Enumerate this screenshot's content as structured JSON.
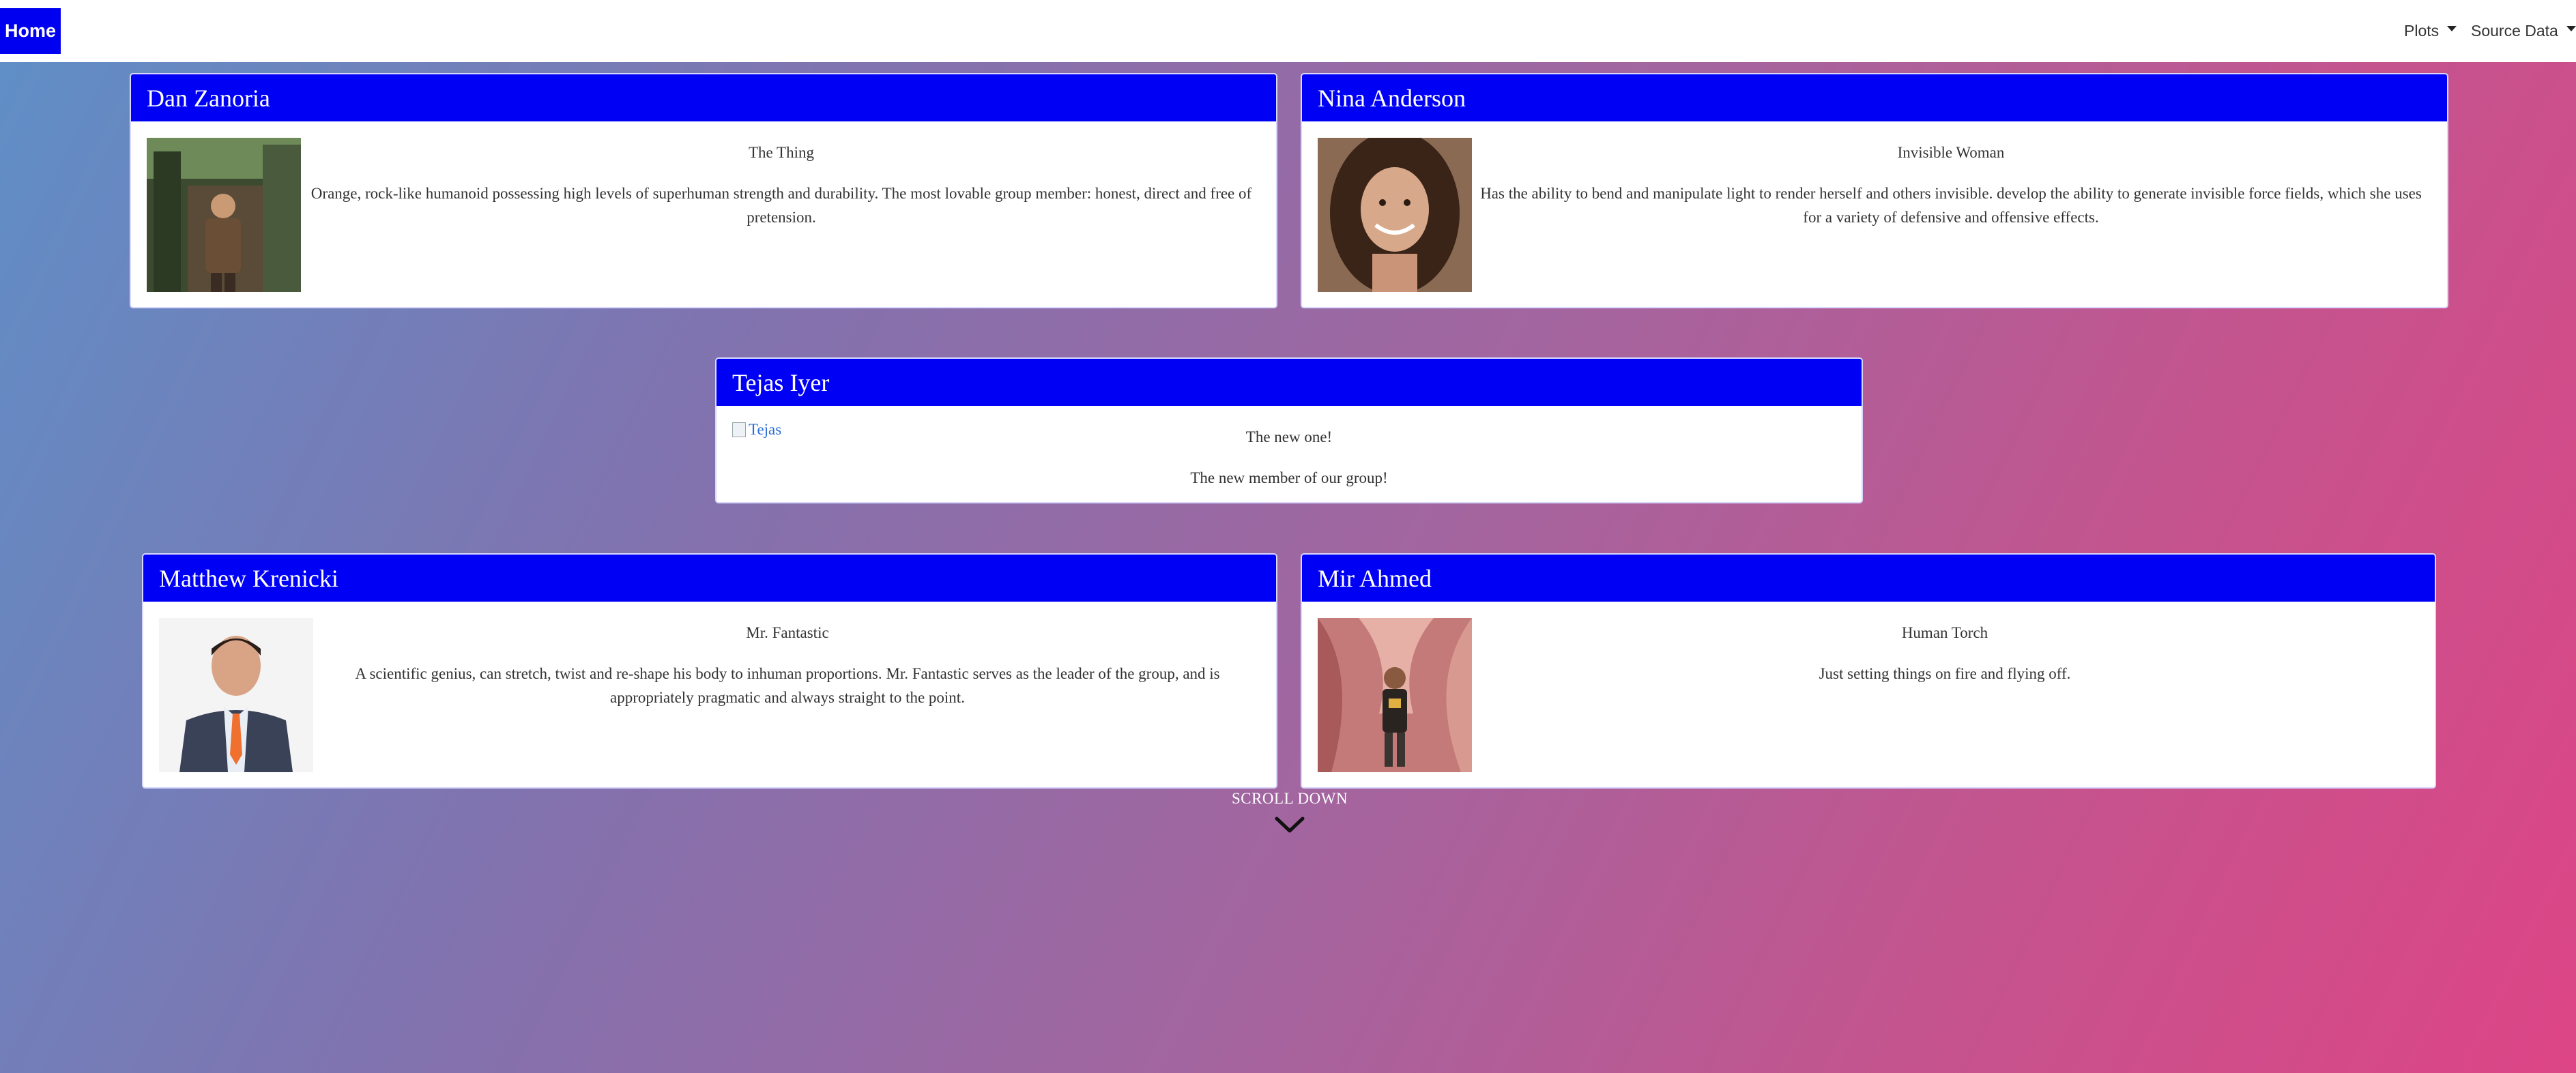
{
  "nav": {
    "home_label": "Home",
    "plots_label": "Plots",
    "source_data_label": "Source Data"
  },
  "cards": {
    "dan": {
      "name": "Dan Zanoria",
      "role": "The Thing",
      "description": "Orange, rock-like humanoid possessing high levels of superhuman strength and durability. The most lovable group member: honest, direct and free of pretension."
    },
    "nina": {
      "name": "Nina Anderson",
      "role": "Invisible Woman",
      "description": "Has the ability to bend and manipulate light to render herself and others invisible. develop the ability to generate invisible force fields, which she uses for a variety of defensive and offensive effects."
    },
    "tejas": {
      "name": "Tejas Iyer",
      "image_alt": "Tejas",
      "role": "The new one!",
      "description": "The new member of our group!"
    },
    "matthew": {
      "name": "Matthew Krenicki",
      "role": "Mr. Fantastic",
      "description": "A scientific genius, can stretch, twist and re-shape his body to inhuman proportions. Mr. Fantastic serves as the leader of the group, and is appropriately pragmatic and always straight to the point."
    },
    "mir": {
      "name": "Mir Ahmed",
      "role": "Human Torch",
      "description": "Just setting things on fire and flying off."
    }
  },
  "scroll_down_label": "SCROLL DOWN",
  "colors": {
    "header_blue": "#0000f5",
    "gradient_start": "#5f8fc7",
    "gradient_end": "#dd4586"
  },
  "icons": {
    "dropdown": "caret-down-icon",
    "scroll": "chevron-down-icon"
  }
}
